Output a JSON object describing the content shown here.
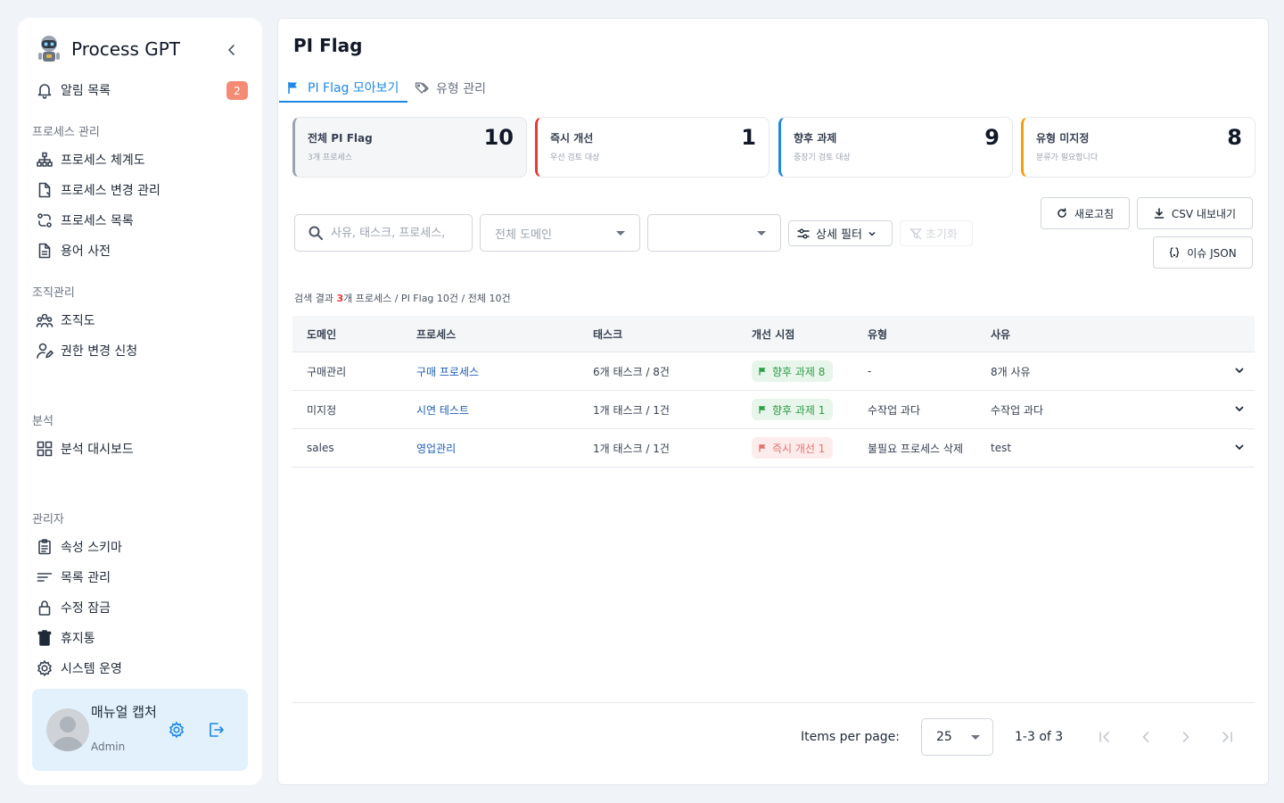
{
  "app": {
    "name": "Process GPT"
  },
  "sidebar": {
    "notifications": {
      "label": "알림 목록",
      "badge": "2"
    },
    "sections": [
      {
        "title": "프로세스 관리",
        "items": [
          "프로세스 체계도",
          "프로세스 변경 관리",
          "프로세스 목록",
          "용어 사전"
        ]
      },
      {
        "title": "조직관리",
        "items": [
          "조직도",
          "권한 변경 신청"
        ]
      },
      {
        "title": "분석",
        "items": [
          "분석 대시보드"
        ]
      },
      {
        "title": "관리자",
        "items": [
          "속성 스키마",
          "목록 관리",
          "수정 잠금",
          "휴지통",
          "시스템 운영"
        ]
      }
    ],
    "user": {
      "name": "매뉴얼 캡처",
      "role": "Admin"
    }
  },
  "page": {
    "title": "PI Flag",
    "tabs": [
      {
        "label": "PI Flag 모아보기",
        "active": true
      },
      {
        "label": "유형 관리",
        "active": false
      }
    ]
  },
  "stats": [
    {
      "label": "전체 PI Flag",
      "sub": "3개 프로세스",
      "value": "10",
      "color": "#9aa4b1"
    },
    {
      "label": "즉시 개선",
      "sub": "우선 검토 대상",
      "value": "1",
      "color": "#e53935"
    },
    {
      "label": "향후 과제",
      "sub": "중장기 검토 대상",
      "value": "9",
      "color": "#1e88e5"
    },
    {
      "label": "유형 미지정",
      "sub": "분류가 필요합니다",
      "value": "8",
      "color": "#f59e0b"
    }
  ],
  "filters": {
    "search_placeholder": "사유, 태스크, 프로세스,",
    "domain_placeholder": "전체 도메인",
    "second_select": "",
    "detail_filter": "상세 필터",
    "reset": "초기화"
  },
  "actions": {
    "refresh": "새로고침",
    "csv": "CSV 내보내기",
    "json": "이슈 JSON"
  },
  "summary": {
    "prefix": "검색 결과 ",
    "count": "3",
    "suffix": "개 프로세스 / PI Flag 10건 / 전체 10건"
  },
  "table": {
    "headers": [
      "도메인",
      "프로세스",
      "태스크",
      "개선 시점",
      "유형",
      "사유"
    ],
    "rows": [
      {
        "domain": "구매관리",
        "process": "구매 프로세스",
        "task": "6개 태스크 / 8건",
        "timing": "향후 과제 8",
        "timing_kind": "future",
        "type": "-",
        "reason": "8개 사유"
      },
      {
        "domain": "미지정",
        "process": "시연 테스트",
        "task": "1개 태스크 / 1건",
        "timing": "향후 과제 1",
        "timing_kind": "future",
        "type": "수작업 과다",
        "reason": "수작업 과다"
      },
      {
        "domain": "sales",
        "process": "영업관리",
        "task": "1개 태스크 / 1건",
        "timing": "즉시 개선 1",
        "timing_kind": "now",
        "type": "불필요 프로세스 삭제",
        "reason": "test"
      }
    ]
  },
  "pagination": {
    "items_per_page_label": "Items per page:",
    "items_per_page": "25",
    "range": "1-3 of 3"
  }
}
